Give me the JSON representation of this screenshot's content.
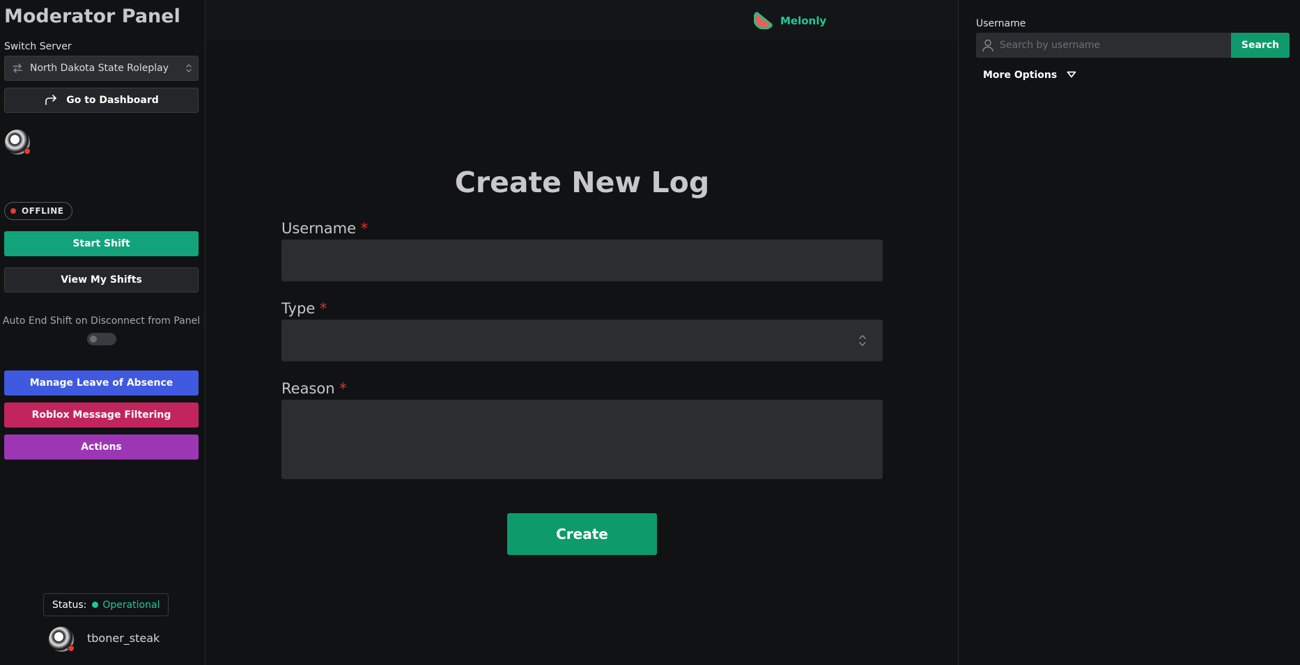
{
  "sidebar": {
    "title": "Moderator Panel",
    "switch_server_label": "Switch Server",
    "server_name": "North Dakota State Roleplay",
    "dashboard_label": "Go to Dashboard",
    "status_badge": "OFFLINE",
    "start_shift_label": "Start Shift",
    "view_shifts_label": "View My Shifts",
    "auto_end_label": "Auto End Shift on Disconnect from Panel",
    "auto_end_enabled": false,
    "loa_label": "Manage Leave of Absence",
    "roblox_filter_label": "Roblox Message Filtering",
    "actions_label": "Actions",
    "system_status_label": "Status:",
    "system_status_value": "Operational",
    "username": "tboner_steak"
  },
  "topbar": {
    "brand": "Melonly"
  },
  "form": {
    "title": "Create New Log",
    "username_label": "Username",
    "type_label": "Type",
    "reason_label": "Reason",
    "required_marker": "*",
    "username_value": "",
    "type_value": "",
    "reason_value": "",
    "submit_label": "Create"
  },
  "search": {
    "label": "Username",
    "placeholder": "Search by username",
    "button_label": "Search",
    "more_options_label": "More Options"
  },
  "colors": {
    "background": "#111214",
    "accent_green": "#12a37a",
    "loa_blue": "#3f5ae0",
    "roblox_pink": "#c2255c",
    "actions_purple": "#9c36b5",
    "required_red": "#e03131",
    "status_green": "#20c997"
  },
  "icons": {
    "server_switch": "swap-arrows-icon",
    "select_caret": "chevron-up-down-icon",
    "dashboard": "redirect-arrow-icon",
    "brand": "watermelon-icon",
    "search_user": "user-icon",
    "more_options": "caret-down-icon"
  }
}
